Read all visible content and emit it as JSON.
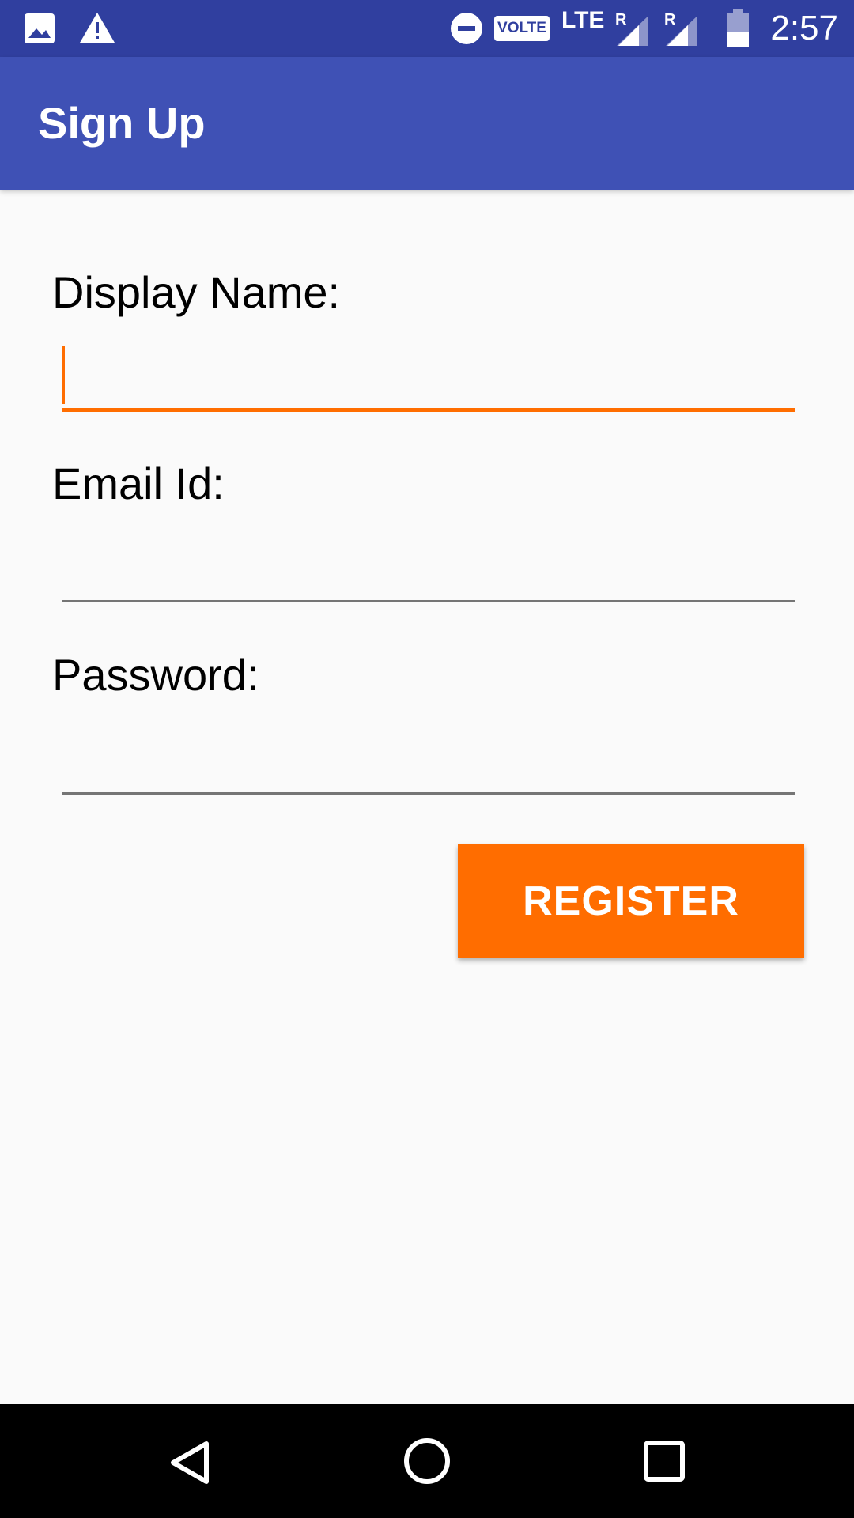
{
  "status_bar": {
    "time": "2:57",
    "network_label": "LTE",
    "volte_label": "VOLTE",
    "roaming_label_1": "R",
    "roaming_label_2": "R",
    "icons": [
      "image-icon",
      "warning-icon",
      "do-not-disturb-icon",
      "volte-icon",
      "signal-icon",
      "signal-icon",
      "battery-icon"
    ],
    "colors": {
      "background": "#303f9f",
      "foreground": "#ffffff"
    }
  },
  "app_bar": {
    "title": "Sign Up",
    "color": "#3f51b5"
  },
  "form": {
    "display_name": {
      "label": "Display Name:",
      "value": "",
      "focused": true
    },
    "email": {
      "label": "Email Id:",
      "value": ""
    },
    "password": {
      "label": "Password:",
      "value": ""
    }
  },
  "register_button": {
    "label": "REGISTER",
    "color": "#ff6d00"
  },
  "accent_color": "#ff6d00",
  "nav_bar": {
    "icons": [
      "back-icon",
      "home-icon",
      "recents-icon"
    ]
  }
}
